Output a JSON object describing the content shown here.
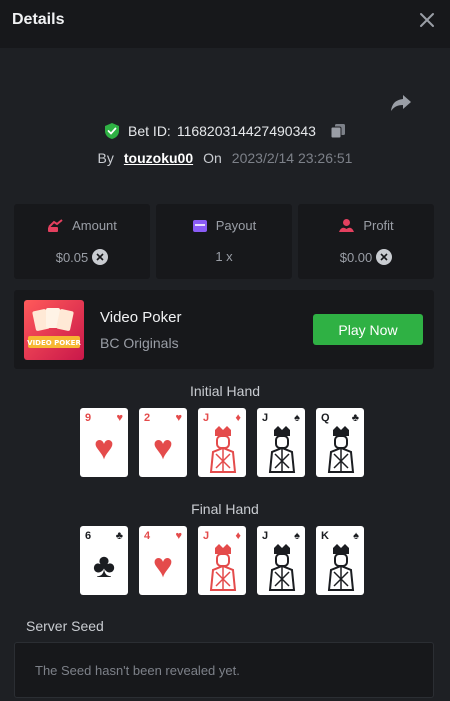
{
  "header": {
    "title": "Details"
  },
  "bet": {
    "label": "Bet ID:",
    "id": "116820314427490343",
    "by_label": "By",
    "user": "touzoku00",
    "on_label": "On",
    "datetime": "2023/2/14 23:26:51"
  },
  "stats": {
    "amount": {
      "label": "Amount",
      "value": "$0.05"
    },
    "payout": {
      "label": "Payout",
      "value": "1 x"
    },
    "profit": {
      "label": "Profit",
      "value": "$0.00"
    }
  },
  "game": {
    "name": "Video Poker",
    "provider": "BC Originals",
    "thumb_text": "VIDEO POKER",
    "play_label": "Play Now"
  },
  "initial_hand": {
    "label": "Initial Hand",
    "cards": [
      {
        "rank": "9",
        "suit": "♥",
        "color": "red"
      },
      {
        "rank": "2",
        "suit": "♥",
        "color": "red"
      },
      {
        "rank": "J",
        "suit": "♦",
        "color": "red"
      },
      {
        "rank": "J",
        "suit": "♠",
        "color": "black"
      },
      {
        "rank": "Q",
        "suit": "♣",
        "color": "black"
      }
    ]
  },
  "final_hand": {
    "label": "Final Hand",
    "cards": [
      {
        "rank": "6",
        "suit": "♣",
        "color": "black"
      },
      {
        "rank": "4",
        "suit": "♥",
        "color": "red"
      },
      {
        "rank": "J",
        "suit": "♦",
        "color": "red"
      },
      {
        "rank": "J",
        "suit": "♠",
        "color": "black"
      },
      {
        "rank": "K",
        "suit": "♠",
        "color": "black"
      }
    ]
  },
  "server_seed": {
    "label": "Server Seed",
    "placeholder": "The Seed hasn't been revealed yet."
  },
  "colors": {
    "background": "#1e2024",
    "panel": "#17181b",
    "accent_green": "#2fb144",
    "suit_red": "#e44b4b"
  }
}
